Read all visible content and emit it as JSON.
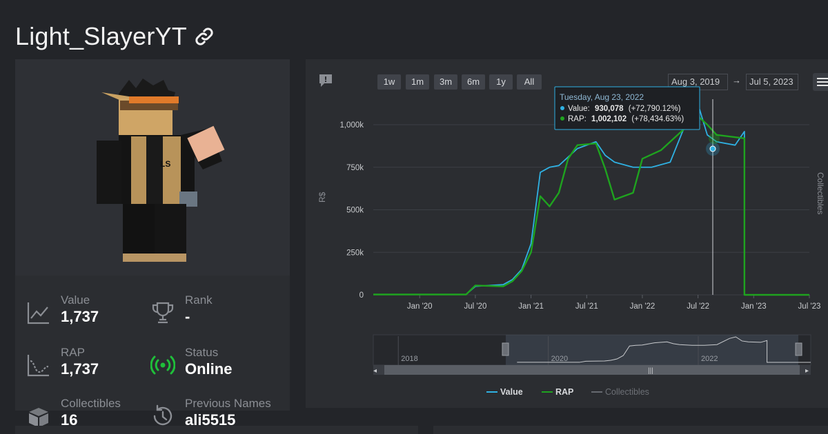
{
  "profile": {
    "username": "Light_SlayerYT",
    "avatar_badge": "LS"
  },
  "stats": {
    "value_label": "Value",
    "value": "1,737",
    "rank_label": "Rank",
    "rank": "-",
    "rap_label": "RAP",
    "rap": "1,737",
    "status_label": "Status",
    "status": "Online",
    "collectibles_label": "Collectibles",
    "collectibles": "16",
    "prev_names_label": "Previous Names",
    "prev_names": "ali5515"
  },
  "chart_controls": {
    "ranges": [
      "1w",
      "1m",
      "3m",
      "6m",
      "1y",
      "All"
    ],
    "from_date": "Aug 3, 2019",
    "arrow": "→",
    "to_date": "Jul 5, 2023"
  },
  "tooltip": {
    "date": "Tuesday, Aug 23, 2022",
    "value_label": "Value:",
    "value": "930,078",
    "value_change": "(+72,790.12%)",
    "rap_label": "RAP:",
    "rap": "1,002,102",
    "rap_change": "(+78,434.63%)"
  },
  "colors": {
    "value": "#2fb1e3",
    "rap": "#1fa31f",
    "collectibles": "#666a70",
    "online": "#1fbf3a"
  },
  "chart_data": {
    "type": "line",
    "ylabel": "R$",
    "y2label": "Collectibles",
    "ylim": [
      0,
      1150000
    ],
    "y_ticks": [
      0,
      250000,
      500000,
      750000,
      1000000
    ],
    "y_tick_labels": [
      "0",
      "250k",
      "500k",
      "750k",
      "1,000k"
    ],
    "x_ticks": [
      "Jan '20",
      "Jul '20",
      "Jan '21",
      "Jul '21",
      "Jan '22",
      "Jul '22",
      "Jan '23",
      "Jul '23"
    ],
    "navigator_labels": [
      "2018",
      "2020",
      "2022"
    ],
    "x_range": [
      "2019-08",
      "2023-07"
    ],
    "series": [
      {
        "name": "Value",
        "points": [
          [
            "2019-08",
            2000
          ],
          [
            "2020-06",
            2000
          ],
          [
            "2020-07",
            50000
          ],
          [
            "2020-10",
            60000
          ],
          [
            "2020-11",
            90000
          ],
          [
            "2020-12",
            150000
          ],
          [
            "2021-01",
            300000
          ],
          [
            "2021-02",
            720000
          ],
          [
            "2021-03",
            750000
          ],
          [
            "2021-04",
            760000
          ],
          [
            "2021-06",
            860000
          ],
          [
            "2021-08",
            900000
          ],
          [
            "2021-09",
            820000
          ],
          [
            "2021-10",
            780000
          ],
          [
            "2021-12",
            750000
          ],
          [
            "2022-02",
            750000
          ],
          [
            "2022-04",
            780000
          ],
          [
            "2022-06",
            1050000
          ],
          [
            "2022-07",
            1120000
          ],
          [
            "2022-08",
            940000
          ],
          [
            "2022-09",
            900000
          ],
          [
            "2022-11",
            880000
          ],
          [
            "2022-12",
            960000
          ],
          [
            "2022-12",
            0
          ],
          [
            "2023-07",
            0
          ]
        ]
      },
      {
        "name": "RAP",
        "points": [
          [
            "2019-08",
            2000
          ],
          [
            "2020-06",
            2000
          ],
          [
            "2020-07",
            55000
          ],
          [
            "2020-10",
            50000
          ],
          [
            "2020-11",
            80000
          ],
          [
            "2020-12",
            140000
          ],
          [
            "2021-01",
            250000
          ],
          [
            "2021-02",
            580000
          ],
          [
            "2021-03",
            520000
          ],
          [
            "2021-04",
            600000
          ],
          [
            "2021-05",
            800000
          ],
          [
            "2021-06",
            880000
          ],
          [
            "2021-08",
            890000
          ],
          [
            "2021-09",
            740000
          ],
          [
            "2021-10",
            560000
          ],
          [
            "2021-11",
            580000
          ],
          [
            "2021-12",
            600000
          ],
          [
            "2022-01",
            800000
          ],
          [
            "2022-03",
            850000
          ],
          [
            "2022-05",
            950000
          ],
          [
            "2022-07",
            1050000
          ],
          [
            "2022-08",
            1000000
          ],
          [
            "2022-09",
            940000
          ],
          [
            "2022-12",
            920000
          ],
          [
            "2022-12",
            0
          ],
          [
            "2023-07",
            0
          ]
        ]
      },
      {
        "name": "Collectibles",
        "points": []
      }
    ]
  }
}
